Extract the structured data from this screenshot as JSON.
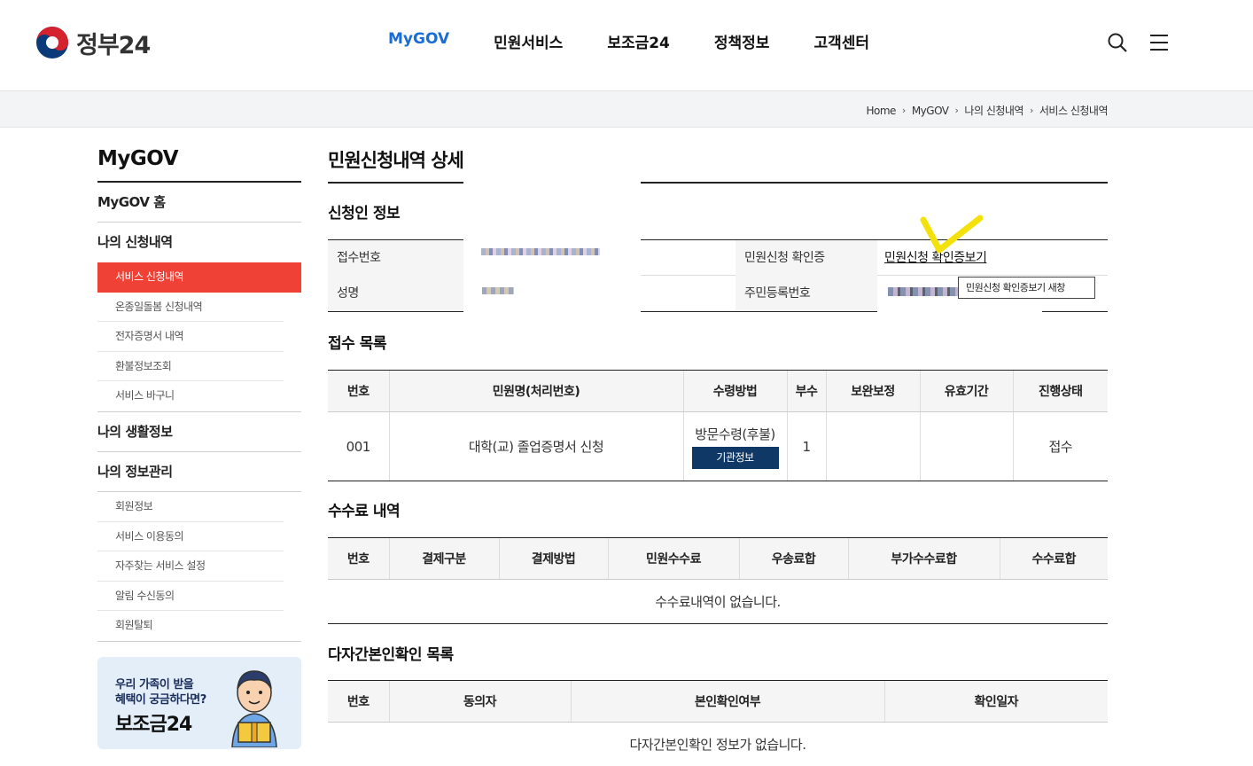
{
  "header": {
    "logo_text": "정부24",
    "nav": [
      "MyGOV",
      "민원서비스",
      "보조금24",
      "정책정보",
      "고객센터"
    ],
    "active_nav": "MyGOV"
  },
  "breadcrumb": [
    "Home",
    "MyGOV",
    "나의 신청내역",
    "서비스 신청내역"
  ],
  "sidebar": {
    "title": "MyGOV",
    "home": "MyGOV 홈",
    "group1": {
      "label": "나의 신청내역",
      "items": [
        "서비스 신청내역",
        "온종일돌봄 신청내역",
        "전자증명서 내역",
        "환불정보조회",
        "서비스 바구니"
      ]
    },
    "group2": {
      "label": "나의 생활정보"
    },
    "group3": {
      "label": "나의 정보관리",
      "items": [
        "회원정보",
        "서비스 이용동의",
        "자주찾는 서비스 설정",
        "알림 수신동의",
        "회원탈퇴"
      ]
    },
    "banner": {
      "line1": "우리 가족이 받을",
      "line2": "혜택이 궁금하다면?",
      "big": "보조금24"
    }
  },
  "content": {
    "title": "민원신청내역 상세조회",
    "applicant": {
      "section_title": "신청인 정보",
      "receipt_no_label": "접수번호",
      "name_label": "성명",
      "certificate_label": "민원신청 확인증",
      "certificate_link": "민원신청 확인증보기",
      "resident_no_label": "주민등록번호",
      "tooltip": "민원신청 확인증보기 새창"
    },
    "receipt_list": {
      "section_title": "접수 목록",
      "columns": [
        "번호",
        "민원명(처리번호)",
        "수령방법",
        "부수",
        "보완보정",
        "유효기간",
        "진행상태"
      ],
      "rows": [
        {
          "no": "001",
          "name": "대학(교) 졸업증명서 신청",
          "method": "방문수령(후불)",
          "button": "기관정보",
          "copies": "1",
          "supplement": "",
          "validity": "",
          "status": "접수"
        }
      ]
    },
    "fee_list": {
      "section_title": "수수료 내역",
      "columns": [
        "번호",
        "결제구분",
        "결제방법",
        "민원수수료",
        "우송료합",
        "부가수수료합",
        "수수료합"
      ],
      "empty": "수수료내역이 없습니다."
    },
    "multi_auth": {
      "section_title": "다자간본인확인 목록",
      "columns": [
        "번호",
        "동의자",
        "본인확인여부",
        "확인일자"
      ],
      "empty": "다자간본인확인 정보가 없습니다."
    }
  },
  "colors": {
    "accent": "#1a6dd6",
    "active_menu": "#ef4136",
    "button_navy": "#0f3866",
    "check_mark": "#f5e10a"
  }
}
